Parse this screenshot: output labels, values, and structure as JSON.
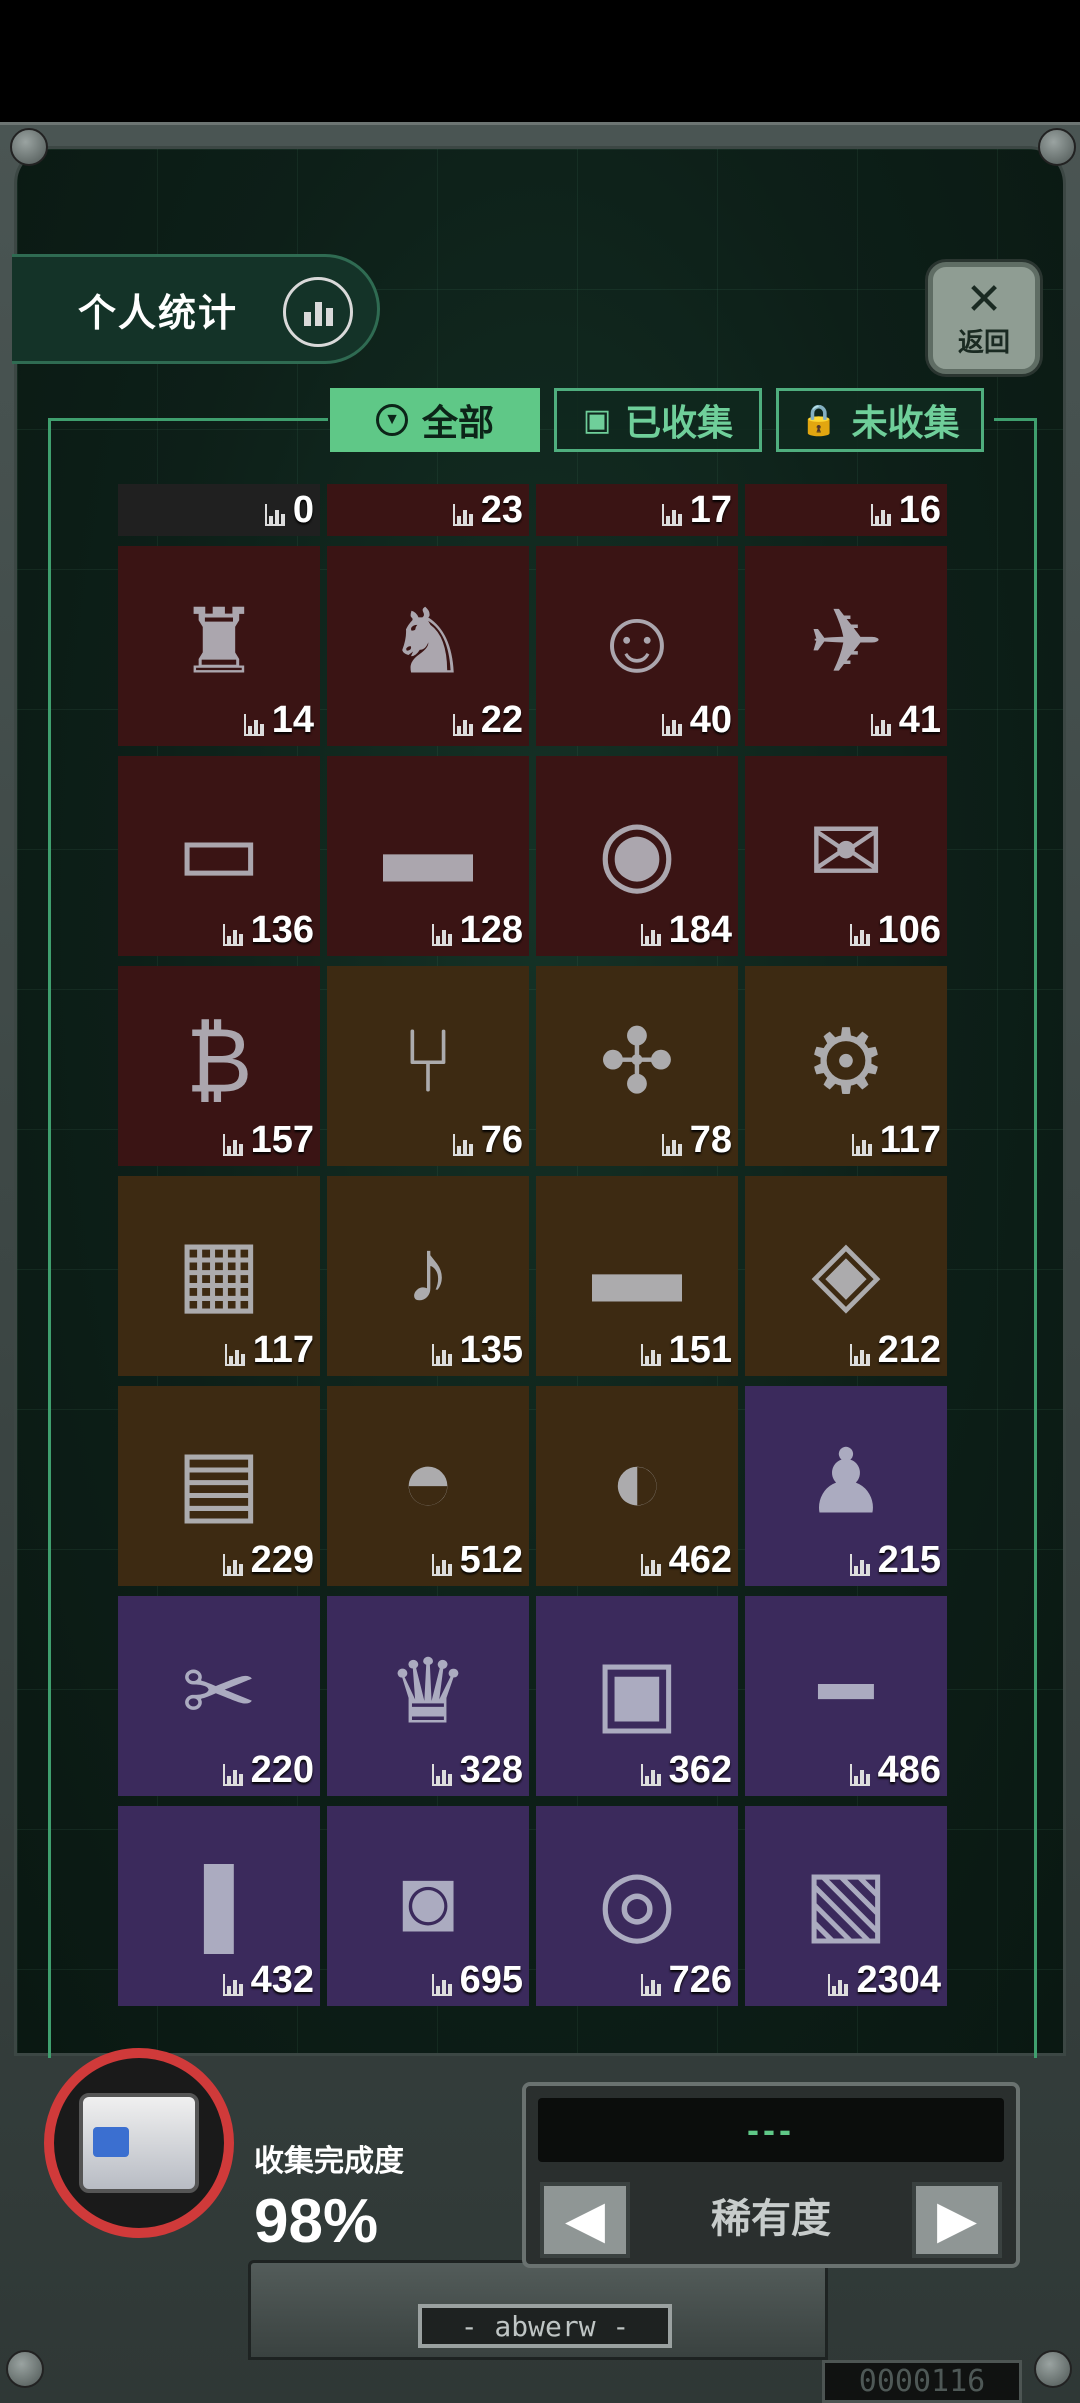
{
  "header": {
    "stats_label": "个人统计",
    "back_label": "返回"
  },
  "tabs": [
    {
      "label": "全部"
    },
    {
      "label": "已收集"
    },
    {
      "label": "未收集"
    }
  ],
  "items": [
    {
      "count": "0",
      "bg": "#202020"
    },
    {
      "count": "23",
      "bg": "#3a1414"
    },
    {
      "count": "17",
      "bg": "#3a1414"
    },
    {
      "count": "16",
      "bg": "#3a1414"
    },
    {
      "count": "14",
      "bg": "#3a1414"
    },
    {
      "count": "22",
      "bg": "#3a1414"
    },
    {
      "count": "40",
      "bg": "#3a1414"
    },
    {
      "count": "41",
      "bg": "#3a1414"
    },
    {
      "count": "136",
      "bg": "#3a1414"
    },
    {
      "count": "128",
      "bg": "#3a1414"
    },
    {
      "count": "184",
      "bg": "#3a1414"
    },
    {
      "count": "106",
      "bg": "#3a1414"
    },
    {
      "count": "157",
      "bg": "#3a1414"
    },
    {
      "count": "76",
      "bg": "#3d2a12"
    },
    {
      "count": "78",
      "bg": "#3d2a12"
    },
    {
      "count": "117",
      "bg": "#3d2a12"
    },
    {
      "count": "117",
      "bg": "#3d2a12"
    },
    {
      "count": "135",
      "bg": "#3d2a12"
    },
    {
      "count": "151",
      "bg": "#3d2a12"
    },
    {
      "count": "212",
      "bg": "#3d2a12"
    },
    {
      "count": "229",
      "bg": "#3d2a12"
    },
    {
      "count": "512",
      "bg": "#3d2a12"
    },
    {
      "count": "462",
      "bg": "#3d2a12"
    },
    {
      "count": "215",
      "bg": "#3b2a5c"
    },
    {
      "count": "220",
      "bg": "#3b2a5c"
    },
    {
      "count": "328",
      "bg": "#3b2a5c"
    },
    {
      "count": "362",
      "bg": "#3b2a5c"
    },
    {
      "count": "486",
      "bg": "#3b2a5c"
    },
    {
      "count": "432",
      "bg": "#3b2a5c"
    },
    {
      "count": "695",
      "bg": "#3b2a5c"
    },
    {
      "count": "726",
      "bg": "#3b2a5c"
    },
    {
      "count": "2304",
      "bg": "#3b2a5c"
    }
  ],
  "footer": {
    "collect_label": "收集完成度",
    "collect_value": "98%",
    "rarity_label": "稀有度",
    "rarity_display": "---",
    "plate_text": "- abwerw -",
    "serial": "0000116"
  },
  "colors": {
    "accent": "#5fc887",
    "rare_red": "#3a1414",
    "rare_gold": "#3d2a12",
    "rare_purple": "#3b2a5c"
  }
}
